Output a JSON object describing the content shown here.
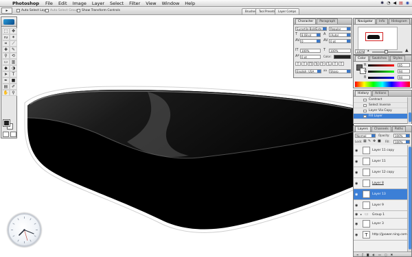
{
  "menubar": {
    "app_name": "Photoshop",
    "items": [
      "File",
      "Edit",
      "Image",
      "Layer",
      "Select",
      "Filter",
      "View",
      "Window",
      "Help"
    ]
  },
  "options_bar": {
    "auto_select_layer": "Auto Select Layer",
    "auto_select_groups": "Auto Select Groups",
    "show_transform_controls": "Show Transform Controls",
    "palette_tabs": [
      "Brushes",
      "Tool Presets",
      "Layer Comps"
    ]
  },
  "character": {
    "tabs": [
      "Character",
      "Paragraph"
    ],
    "font_family": "Eurostile-BoldExte...",
    "font_style": "Regular",
    "font_size": "8.08 pt",
    "leading": "(Auto)",
    "tracking": "0 pt",
    "kerning": "0",
    "vertical_scale": "100%",
    "horizontal_scale": "100%",
    "baseline_shift": "0 pt",
    "color_label": "Color:",
    "language": "English: USA",
    "antialias": "Sharp"
  },
  "navigator": {
    "tabs": [
      "Navigator",
      "Info",
      "Histogram"
    ],
    "zoom": "100%"
  },
  "color_palette": {
    "tabs": [
      "Color",
      "Swatches",
      "Styles"
    ],
    "channels": [
      {
        "name": "R",
        "value": "95"
      },
      {
        "name": "G",
        "value": "94"
      },
      {
        "name": "B",
        "value": "94"
      }
    ]
  },
  "history": {
    "tabs": [
      "History",
      "Actions"
    ],
    "items": [
      "Contract",
      "Select Inverse",
      "Layer Via Copy",
      "Fill Layer"
    ],
    "active_index": 3
  },
  "layers": {
    "tabs": [
      "Layers",
      "Channels",
      "Paths"
    ],
    "blend_mode": "Normal",
    "opacity_label": "Opacity:",
    "opacity": "100%",
    "lock_label": "Lock:",
    "fill_label": "Fill:",
    "fill": "100%",
    "items": [
      {
        "name": "Layer 11 copy"
      },
      {
        "name": "Layer 11"
      },
      {
        "name": "Layer 12 copy"
      },
      {
        "name": "Layer 8"
      },
      {
        "name": "Layer 13"
      },
      {
        "name": "Layer 9"
      },
      {
        "name": "Group 1"
      },
      {
        "name": "Layer 3"
      },
      {
        "name": "http://jpower.ning.com"
      }
    ],
    "active_index": 4
  },
  "colors": {
    "selection": "#3c7fd6",
    "foreground": "#222222",
    "shape_fill": "#000000"
  }
}
